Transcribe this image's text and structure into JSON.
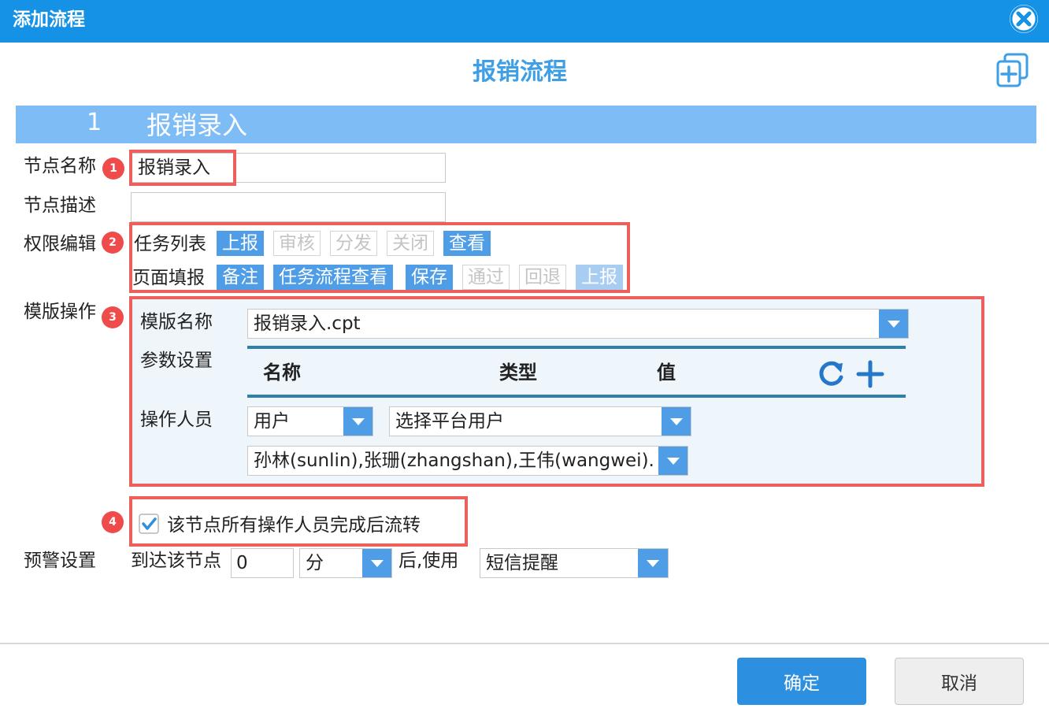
{
  "dialog": {
    "title": "添加流程"
  },
  "flow": {
    "title": "报销流程"
  },
  "section": {
    "number": "1",
    "name": "报销录入"
  },
  "badges": [
    "1",
    "2",
    "3",
    "4"
  ],
  "node_name": {
    "label": "节点名称",
    "value": "报销录入"
  },
  "node_desc": {
    "label": "节点描述",
    "value": ""
  },
  "permissions": {
    "label": "权限编辑",
    "task_list": {
      "label": "任务列表",
      "tags": [
        {
          "text": "上报",
          "state": "on"
        },
        {
          "text": "审核",
          "state": "off"
        },
        {
          "text": "分发",
          "state": "off"
        },
        {
          "text": "关闭",
          "state": "off"
        },
        {
          "text": "查看",
          "state": "on"
        }
      ]
    },
    "page_fill": {
      "label": "页面填报",
      "tags": [
        {
          "text": "备注",
          "state": "on"
        },
        {
          "text": "任务流程查看",
          "state": "on"
        },
        {
          "text": "保存",
          "state": "on"
        },
        {
          "text": "通过",
          "state": "off"
        },
        {
          "text": "回退",
          "state": "off"
        },
        {
          "text": "上报",
          "state": "dim"
        }
      ]
    }
  },
  "template_ops": {
    "label": "模版操作",
    "template_name_label": "模版名称",
    "template_name_value": "报销录入.cpt",
    "params_label": "参数设置",
    "params_columns": {
      "name": "名称",
      "type": "类型",
      "value": "值"
    },
    "operators_label": "操作人员",
    "operator_type": "用户",
    "operator_source": "选择平台用户",
    "operator_list": "孙林(sunlin),张珊(zhangshan),王伟(wangwei)..."
  },
  "transfer_checkbox": {
    "label": "该节点所有操作人员完成后流转",
    "checked": true
  },
  "warning": {
    "label": "预警设置",
    "prefix": "到达该节点",
    "amount": "0",
    "unit": "分",
    "middle": "后,使用",
    "method": "短信提醒"
  },
  "footer": {
    "ok": "确定",
    "cancel": "取消"
  },
  "colors": {
    "titlebar": "#1592e6",
    "accent": "#4f9de6",
    "highlight": "#ec5f5a",
    "band": "#7ebcf5"
  },
  "icons": [
    "close-icon",
    "add-node-icon",
    "refresh-icon",
    "plus-icon",
    "chevron-down-icon",
    "checkbox-checked-icon"
  ]
}
